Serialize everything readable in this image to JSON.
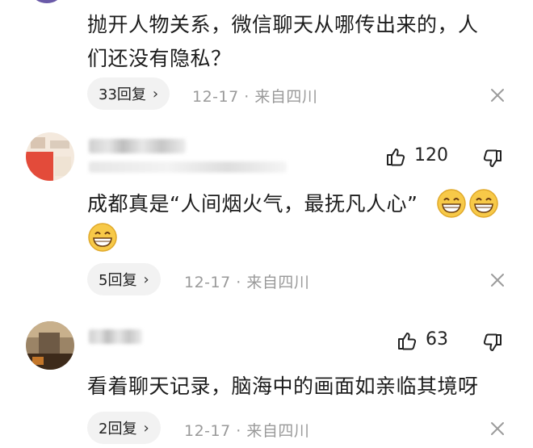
{
  "comments": [
    {
      "text_line1": "抛开人物关系，微信聊天从哪传出来的，人",
      "text_line2": "们还没有隐私？",
      "reply_label": "33回复",
      "meta": "12-17 · 来自四川"
    },
    {
      "like_count": "120",
      "text_line1": "成都真是“人间烟火气，最抚凡人心”",
      "reply_label": "5回复",
      "meta": "12-17 · 来自四川"
    },
    {
      "like_count": "63",
      "text_line1": "看着聊天记录，脑海中的画面如亲临其境呀",
      "reply_label": "2回复",
      "meta": "12-17 · 来自四川"
    }
  ],
  "icons": {
    "chevron": "›",
    "emoji": "grinning-face-icon"
  },
  "colors": {
    "meta": "#9a9a9a",
    "pill_bg": "#f2f2f2",
    "emoji_fill": "#f7c948"
  }
}
